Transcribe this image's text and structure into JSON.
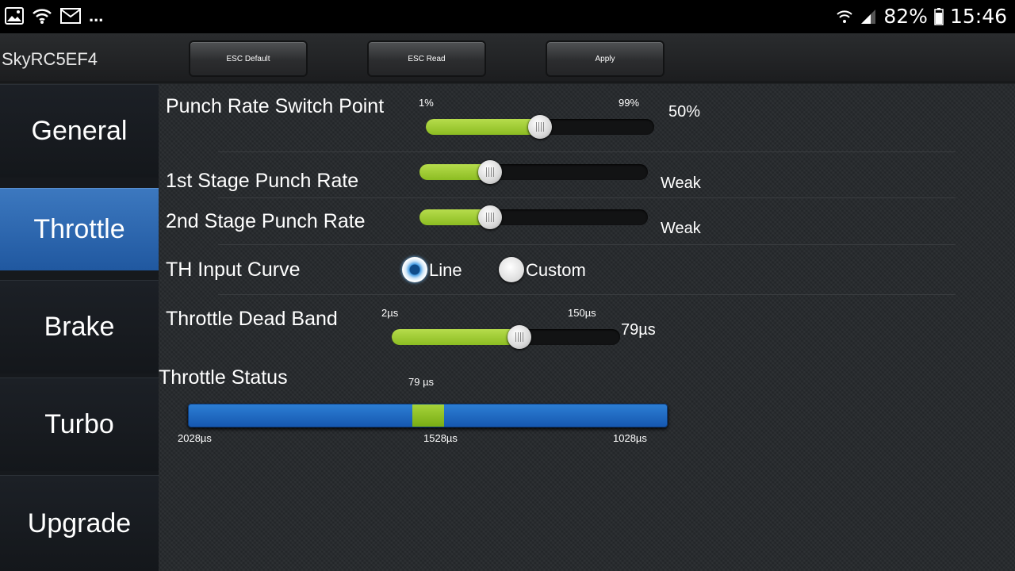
{
  "status_bar": {
    "battery": "82%",
    "time": "15:46",
    "notification_icons": [
      "gallery-icon",
      "wifi-icon",
      "mail-icon"
    ],
    "more": "..."
  },
  "app_bar": {
    "title": "SkyRC5EF4",
    "buttons": {
      "esc_default": "ESC Default",
      "esc_read": "ESC Read",
      "apply": "Apply"
    }
  },
  "sidebar": {
    "items": [
      {
        "label": "General"
      },
      {
        "label": "Throttle",
        "active": true
      },
      {
        "label": "Brake"
      },
      {
        "label": "Turbo"
      },
      {
        "label": "Upgrade"
      }
    ]
  },
  "throttle": {
    "punch_rate_switch_point": {
      "label": "Punch Rate Switch Point",
      "min_label": "1%",
      "max_label": "99%",
      "value": "50%",
      "fraction": 0.5
    },
    "stage1_punch_rate": {
      "label": "1st Stage Punch Rate",
      "value": "Weak",
      "fraction": 0.31
    },
    "stage2_punch_rate": {
      "label": "2nd Stage Punch Rate",
      "value": "Weak",
      "fraction": 0.31
    },
    "th_input_curve": {
      "label": "TH Input Curve",
      "options": [
        "Line",
        "Custom"
      ],
      "selected": "Line"
    },
    "throttle_dead_band": {
      "label": "Throttle Dead Band",
      "min_label": "2µs",
      "max_label": "150µs",
      "value": "79µs",
      "fraction": 0.56
    },
    "throttle_status": {
      "label": "Throttle Status",
      "marker_value": "79 µs",
      "scale_left": "2028µs",
      "scale_mid": "1528µs",
      "scale_right": "1028µs",
      "marker_fraction": 0.5
    }
  },
  "colors": {
    "accent_blue": "#2a66b0",
    "slider_green": "#9fcd36",
    "status_blue": "#1e6cc4"
  }
}
